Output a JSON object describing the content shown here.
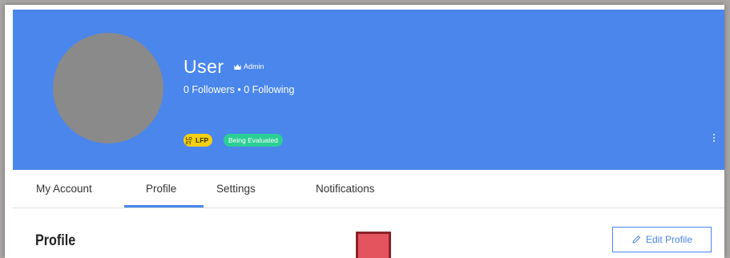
{
  "profile": {
    "username": "User",
    "role_label": "Admin",
    "follow_stats": "0 Followers • 0 Following",
    "badges": {
      "lfp_label": "LFP",
      "status_label": "Being Evaluated"
    }
  },
  "tabs": [
    {
      "label": "My Account"
    },
    {
      "label": "Profile",
      "active": true
    },
    {
      "label": "Settings"
    },
    {
      "label": "Notifications"
    }
  ],
  "section": {
    "title": "Profile",
    "edit_label": "Edit Profile"
  },
  "colors": {
    "header": "#4a86ec",
    "lfp_badge": "#f3cf13",
    "status_badge": "#2bcf95",
    "marker": "#e4545f"
  }
}
